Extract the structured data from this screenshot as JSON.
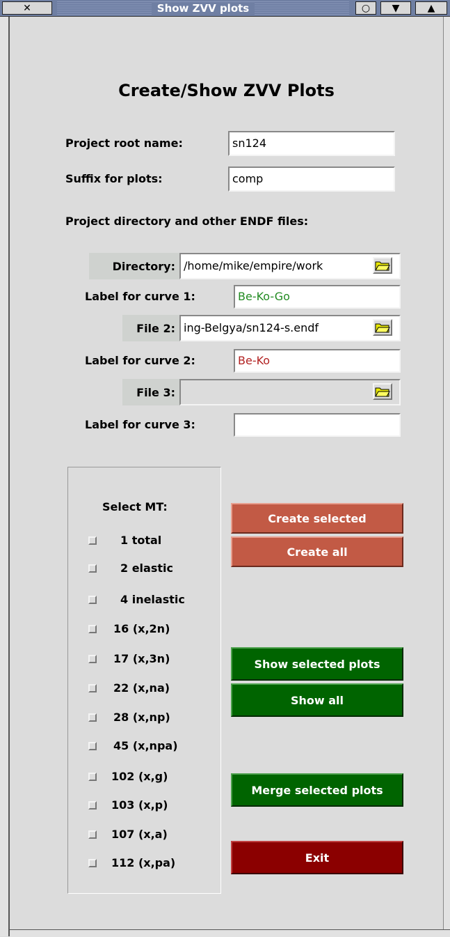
{
  "window": {
    "title": "Show ZVV plots",
    "close_glyph": "✕",
    "iconify_glyph": "○",
    "menu_glyph": "▼",
    "maximize_glyph": "▲"
  },
  "heading": "Create/Show ZVV Plots",
  "fields": {
    "project_root_label": "Project root name:",
    "project_root_value": "sn124",
    "suffix_label": "Suffix for plots:",
    "suffix_value": "comp"
  },
  "files_section": {
    "heading": "Project directory and other ENDF files:",
    "directory_label": "Directory:",
    "directory_value": "/home/mike/empire/work",
    "curve1_label": "Label for curve 1:",
    "curve1_value": "Be-Ko-Go",
    "file2_label": "File 2:",
    "file2_value": "ing-Belgya/sn124-s.endf",
    "curve2_label": "Label for curve 2:",
    "curve2_value": "Be-Ko",
    "file3_label": "File 3:",
    "file3_value": "",
    "curve3_label": "Label for curve 3:",
    "curve3_value": ""
  },
  "colors": {
    "curve1": "#228b22",
    "curve2": "#b22222",
    "create": "#c25a45",
    "show": "#006400",
    "exit": "#8b0000"
  },
  "mt": {
    "heading": "Select MT:",
    "items": [
      "1 total",
      "2 elastic",
      "4 inelastic",
      "16 (x,2n)",
      "17 (x,3n)",
      "22 (x,na)",
      "28 (x,np)",
      "45 (x,npa)",
      "102 (x,g)",
      "103 (x,p)",
      "107 (x,a)",
      "112 (x,pa)"
    ]
  },
  "buttons": {
    "create_selected": "Create selected",
    "create_all": "Create all",
    "show_selected": "Show selected plots",
    "show_all": "Show all",
    "merge_selected": "Merge selected plots",
    "exit": "Exit"
  }
}
